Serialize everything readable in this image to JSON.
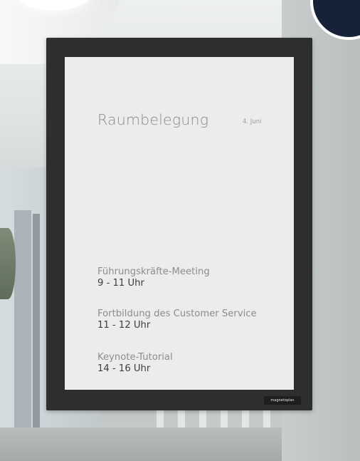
{
  "sign": {
    "title": "Raumbelegung",
    "date": "4. Juni",
    "events": [
      {
        "name": "Führungskräfte-Meeting",
        "time": "9 - 11 Uhr"
      },
      {
        "name": "Fortbildung des Customer Service",
        "time": "11 - 12 Uhr"
      },
      {
        "name": "Keynote-Tutorial",
        "time": "14 - 16 Uhr"
      }
    ],
    "brand": "magnetoplan"
  },
  "colors": {
    "frame": "#2e2e2d",
    "paper": "#ececec",
    "badge": "#152238"
  },
  "icons": [
    "corner-badge-icon"
  ]
}
